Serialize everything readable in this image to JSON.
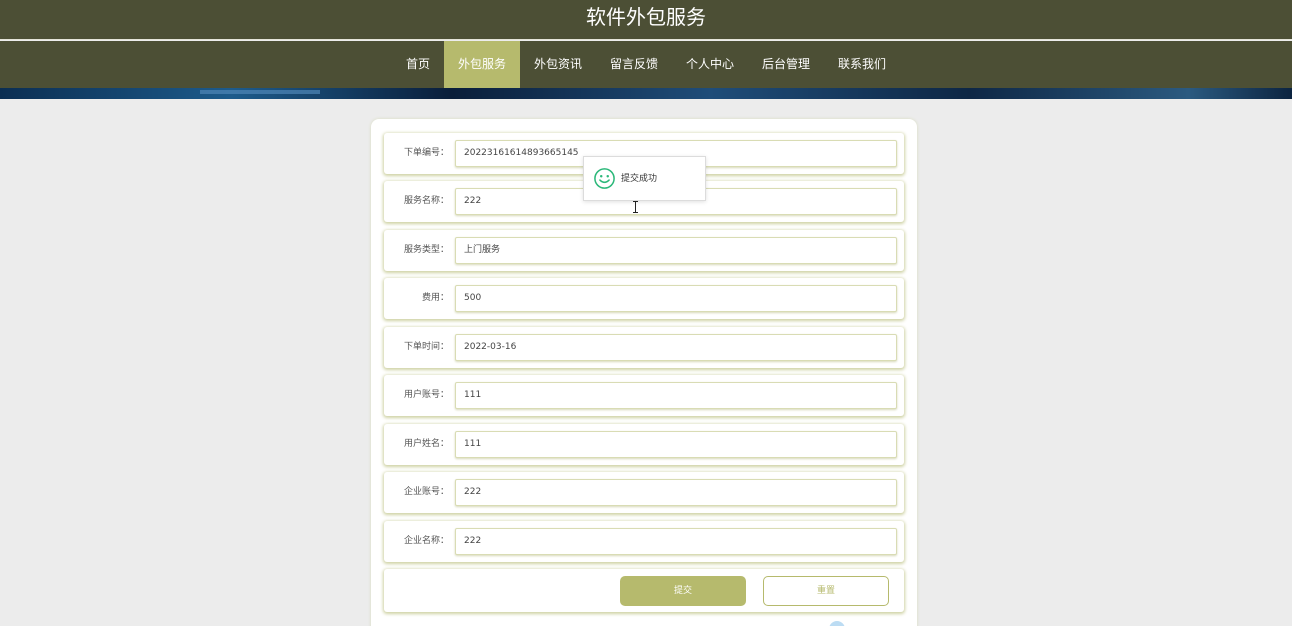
{
  "header": {
    "title": "软件外包服务"
  },
  "nav": {
    "items": [
      "首页",
      "外包服务",
      "外包资讯",
      "留言反馈",
      "个人中心",
      "后台管理",
      "联系我们"
    ],
    "active_index": 1
  },
  "form": {
    "fields": [
      {
        "label": "下单编号：",
        "value": "20223161614893665145"
      },
      {
        "label": "服务名称：",
        "value": "222"
      },
      {
        "label": "服务类型：",
        "value": "上门服务"
      },
      {
        "label": "费用：",
        "value": "500"
      },
      {
        "label": "下单时间：",
        "value": "2022-03-16"
      },
      {
        "label": "用户账号：",
        "value": "111"
      },
      {
        "label": "用户姓名：",
        "value": "111"
      },
      {
        "label": "企业账号：",
        "value": "222"
      },
      {
        "label": "企业名称：",
        "value": "222"
      }
    ],
    "submit_label": "提交",
    "reset_label": "重置"
  },
  "toast": {
    "message": "提交成功",
    "icon": "smile-icon"
  },
  "colors": {
    "header_bg": "#4c4f35",
    "accent": "#b6ba6d",
    "page_bg": "#ececec",
    "toast_icon": "#2cb87a"
  }
}
